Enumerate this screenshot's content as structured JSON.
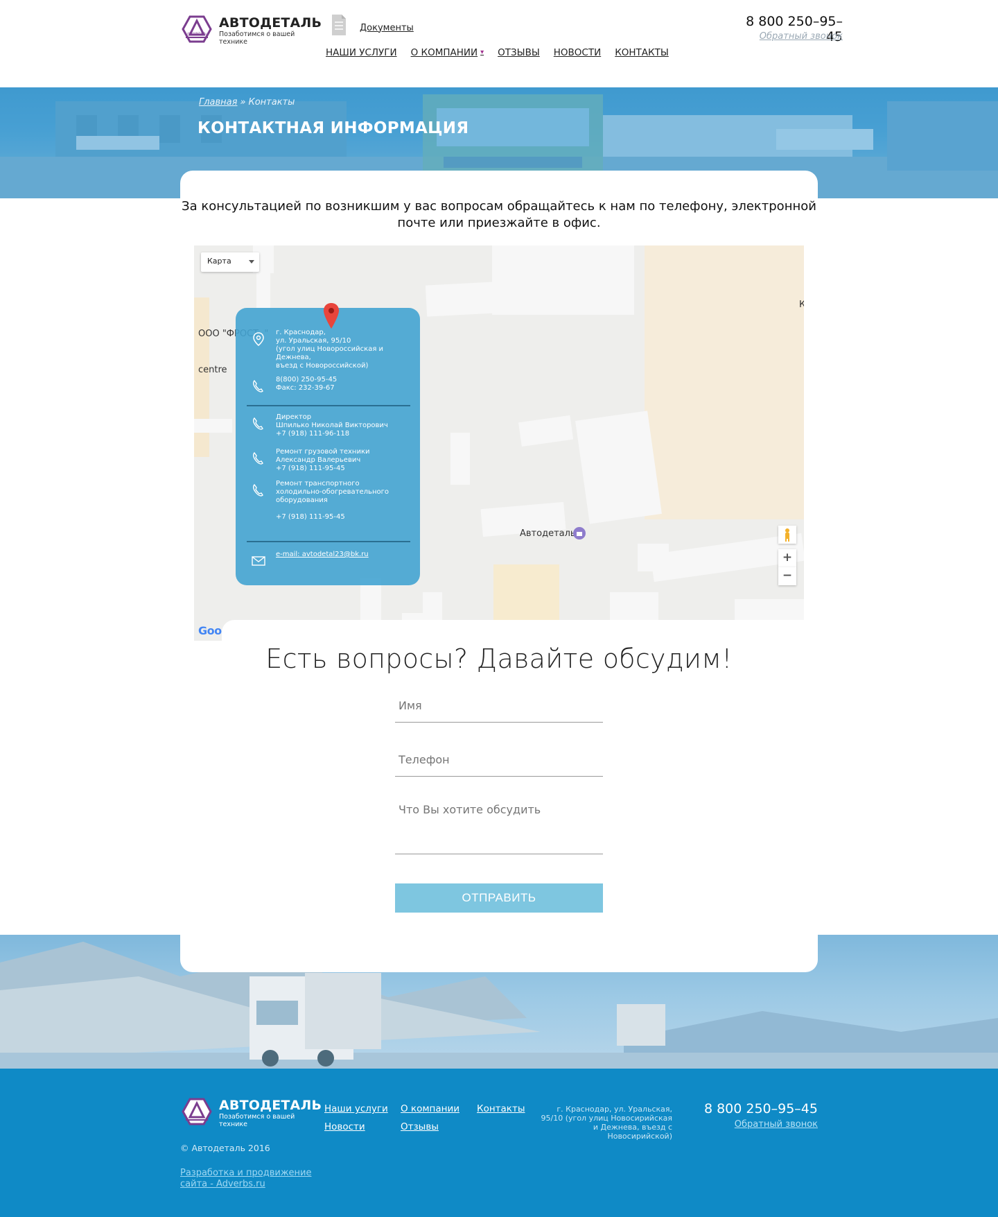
{
  "header": {
    "logo_name": "АВТОДЕТАЛЬ",
    "logo_tagline": "Позаботимся о вашей технике",
    "logo_small": "АВТОДЕТАЛЬ",
    "documents_link": "Документы",
    "phone": "8 800 250–95–45",
    "callback": "Обратный звонок",
    "nav": [
      "НАШИ УСЛУГИ",
      "О КОМПАНИИ",
      "ОТЗЫВЫ",
      "НОВОСТИ",
      "КОНТАКТЫ"
    ]
  },
  "banner": {
    "breadcrumb_home": "Главная",
    "breadcrumb_sep": "»",
    "breadcrumb_current": "Контакты",
    "title": "КОНТАКТНАЯ ИНФОРМАЦИЯ"
  },
  "intro": "За консультацией по возникшим у вас вопросам обращайтесь к нам по телефону, электронной почте или приезжайте в офис.",
  "map": {
    "type_select": "Карта",
    "label_frost": "ООО \"ФРОСТ..\"",
    "label_centre": "centre",
    "label_place": "Автодеталь",
    "label_edge": "К",
    "google": "Goo",
    "zoom_in": "+",
    "zoom_out": "−"
  },
  "info": {
    "address": "г. Краснодар,\nул. Уральская, 95/10\n(угол улиц Новороссийская и Дежнева,\nвъезд с Новороссийской)",
    "phones": "8(800) 250-95-45\nФакс: 232-39-67",
    "director": "Директор\nШпилько Николай Викторович\n+7 (918) 111-96-118",
    "repair": "Ремонт грузовой техники\nАлександр Валерьевич\n+7 (918) 111-95-45",
    "equipment": "Ремонт транспортного\nхолодильно-обогревательного\nоборудования\n\n+7 (918) 111-95-45",
    "email": "e-mail: avtodetal23@bk.ru"
  },
  "form": {
    "title": "Есть вопросы? Давайте обсудим!",
    "name_placeholder": "Имя",
    "phone_placeholder": "Телефон",
    "message_placeholder": "Что Вы хотите обсудить",
    "submit": "ОТПРАВИТЬ"
  },
  "footer": {
    "logo_name": "АВТОДЕТАЛЬ",
    "logo_tagline": "Позаботимся о вашей технике",
    "copyright": "© Автодеталь 2016",
    "developer": "Разработка и продвижение сайта - Adverbs.ru",
    "nav": [
      "Наши услуги",
      "О компании",
      "Контакты",
      "Новости",
      "Отзывы"
    ],
    "address": "г. Краснодар, ул. Уральская, 95/10 (угол улиц Новосирийская и Дежнева, въезд с Новосирийской)",
    "phone": "8 800 250–95–45",
    "callback": "Обратный звонок"
  },
  "colors": {
    "accent": "#0f8ac6",
    "brand_purple": "#7b3d8f",
    "info_panel": "#42a3d2",
    "button": "#7ec6e0"
  }
}
